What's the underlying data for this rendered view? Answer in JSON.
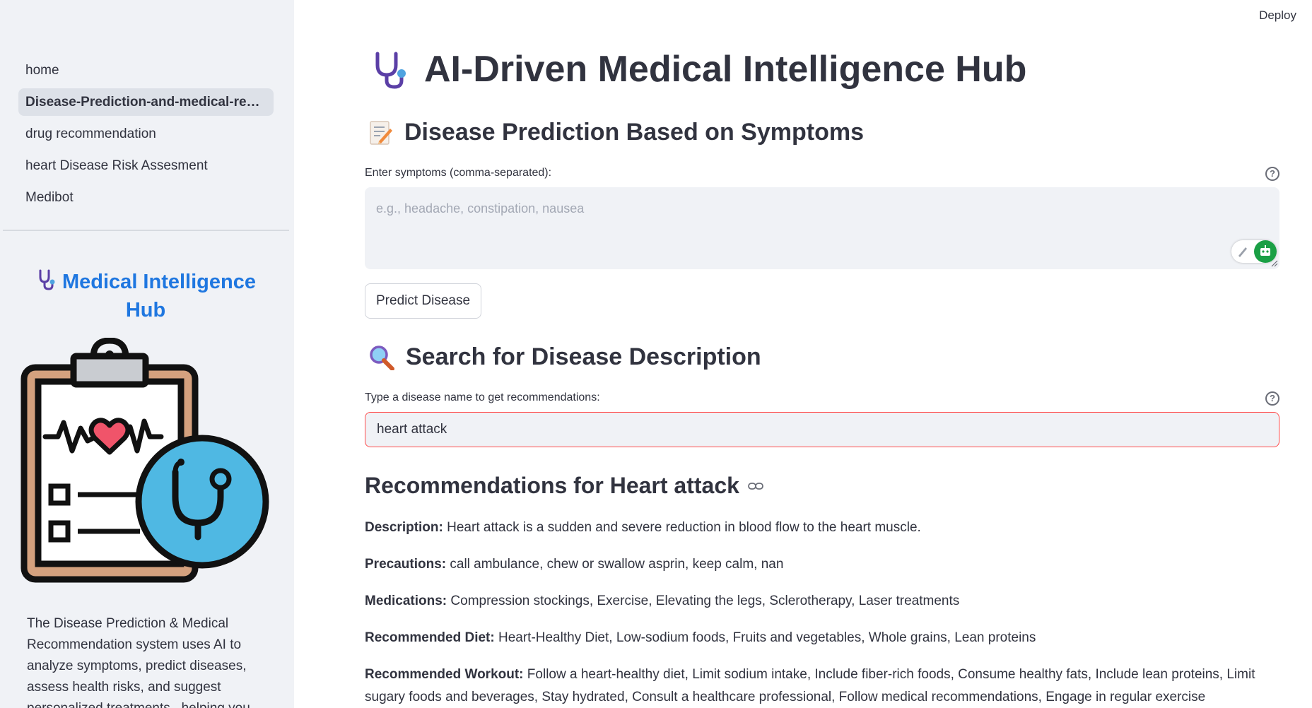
{
  "header": {
    "deploy_label": "Deploy"
  },
  "sidebar": {
    "nav": [
      {
        "label": "home",
        "active": false
      },
      {
        "label": "Disease-Prediction-and-medical-reco...",
        "active": true
      },
      {
        "label": "drug recommendation",
        "active": false
      },
      {
        "label": "heart Disease Risk Assesment",
        "active": false
      },
      {
        "label": "Medibot",
        "active": false
      }
    ],
    "brand_line1": "Medical Intelligence",
    "brand_line2": "Hub",
    "about_text": "The Disease Prediction & Medical Recommendation system uses AI to analyze symptoms, predict diseases, assess health risks, and suggest personalized treatments , helping you"
  },
  "main": {
    "title": "AI-Driven Medical Intelligence Hub",
    "prediction": {
      "heading": "Disease Prediction Based on Symptoms",
      "label": "Enter symptoms (comma-separated):",
      "placeholder": "e.g., headache, constipation, nausea",
      "value": "",
      "button": "Predict Disease"
    },
    "search": {
      "heading": "Search for Disease Description",
      "label": "Type a disease name to get recommendations:",
      "value": "heart attack"
    },
    "recommendations": {
      "title": "Recommendations for Heart attack",
      "items": [
        {
          "label": "Description:",
          "text": "Heart attack is a sudden and severe reduction in blood flow to the heart muscle."
        },
        {
          "label": "Precautions:",
          "text": "call ambulance, chew or swallow asprin, keep calm, nan"
        },
        {
          "label": "Medications:",
          "text": "Compression stockings, Exercise, Elevating the legs, Sclerotherapy, Laser treatments"
        },
        {
          "label": "Recommended Diet:",
          "text": "Heart-Healthy Diet, Low-sodium foods, Fruits and vegetables, Whole grains, Lean proteins"
        },
        {
          "label": "Recommended Workout:",
          "text": "Follow a heart-healthy diet, Limit sodium intake, Include fiber-rich foods, Consume healthy fats, Include lean proteins, Limit sugary foods and beverages, Stay hydrated, Consult a healthcare professional, Follow medical recommendations, Engage in regular exercise"
        }
      ]
    }
  },
  "colors": {
    "brand": "#1f77e0",
    "error_border": "#ff4b4b",
    "sidebar_bg": "#f0f2f6"
  }
}
